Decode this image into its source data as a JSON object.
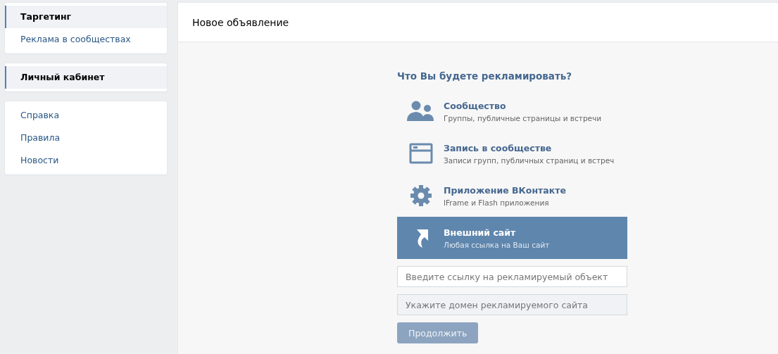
{
  "sidebar": {
    "groups": [
      {
        "items": [
          {
            "label": "Таргетинг",
            "selected": true
          },
          {
            "label": "Реклама в сообществах",
            "selected": false
          }
        ]
      },
      {
        "items": [
          {
            "label": "Личный кабинет",
            "selected": true
          }
        ]
      },
      {
        "items": [
          {
            "label": "Справка",
            "selected": false
          },
          {
            "label": "Правила",
            "selected": false
          },
          {
            "label": "Новости",
            "selected": false
          }
        ]
      }
    ]
  },
  "panel": {
    "title": "Новое объявление",
    "question": "Что Вы будете рекламировать?",
    "options": [
      {
        "kind": "people",
        "title": "Сообщество",
        "subtitle": "Группы, публичные страницы и встречи",
        "selected": false
      },
      {
        "kind": "post",
        "title": "Запись в сообществе",
        "subtitle": "Записи групп, публичных страниц и встреч",
        "selected": false
      },
      {
        "kind": "gear",
        "title": "Приложение ВКонтакте",
        "subtitle": "IFrame и Flash приложения",
        "selected": false
      },
      {
        "kind": "share",
        "title": "Внешний сайт",
        "subtitle": "Любая ссылка на Ваш сайт",
        "selected": true
      }
    ],
    "fields": [
      {
        "placeholder": "Введите ссылку на рекламируемый объект",
        "disabled": false
      },
      {
        "placeholder": "Укажите домен рекламируемого сайта",
        "disabled": true
      }
    ],
    "submit": {
      "label": "Продолжить",
      "disabled": true
    }
  }
}
